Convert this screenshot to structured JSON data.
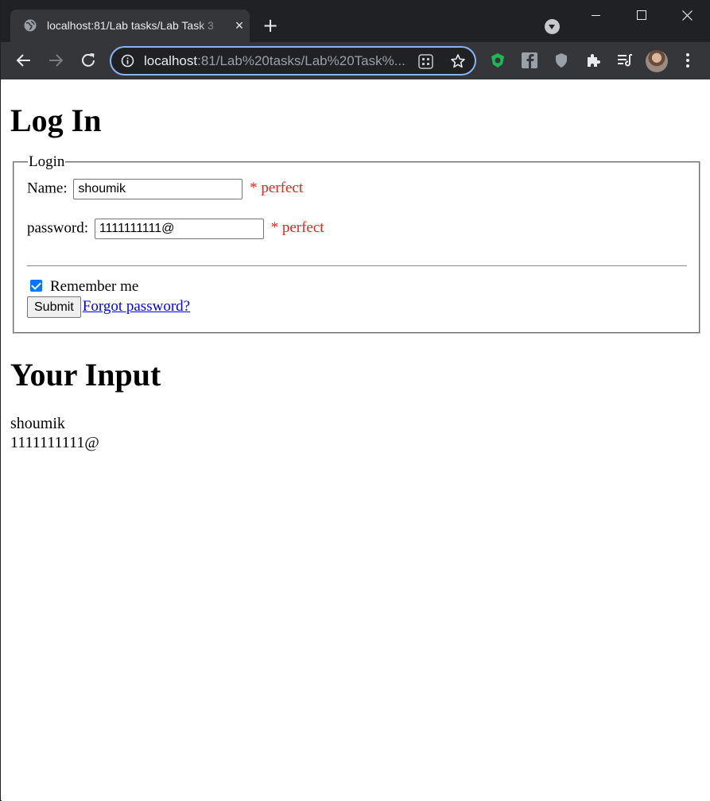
{
  "browser": {
    "tab_title": "localhost:81/Lab tasks/Lab Task 3",
    "new_tab_symbol": "+",
    "close_symbol": "×",
    "url_host": "localhost",
    "url_rest": ":81/Lab%20tasks/Lab%20Task%..."
  },
  "page": {
    "heading": "Log In",
    "form": {
      "legend": "Login",
      "name_label": "Name:",
      "name_value": "shoumik",
      "name_status": "* perfect",
      "password_label": "password:",
      "password_value": "1111111111@",
      "password_status": "* perfect",
      "remember_label": "Remember me",
      "remember_checked": true,
      "submit_label": "Submit",
      "forgot_link": "Forgot password?"
    },
    "output_heading": "Your Input",
    "output_lines": [
      "shoumik",
      "1111111111@"
    ]
  },
  "colors": {
    "status_text": "#e8231b",
    "link": "#0000ee",
    "checkbox_accent": "#0075ff",
    "omnibox_focus": "#8ab4f8"
  }
}
